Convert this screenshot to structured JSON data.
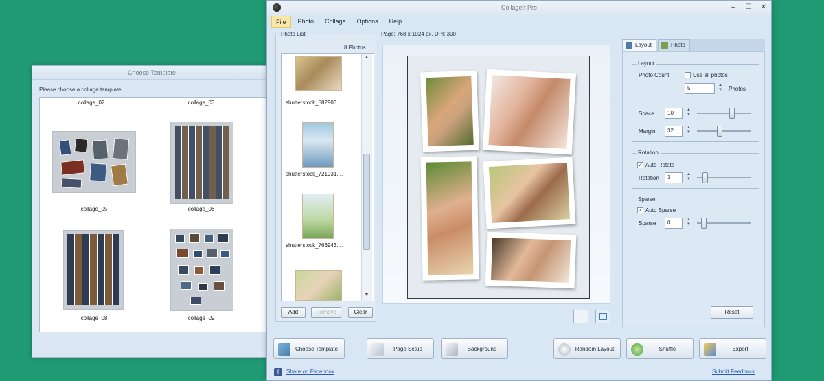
{
  "template_window": {
    "title": "Choose Template",
    "prompt": "Please choose a collage template",
    "templates": [
      {
        "label": "collage_02"
      },
      {
        "label": "collage_03"
      },
      {
        "label": "collage_05"
      },
      {
        "label": "collage_06"
      },
      {
        "label": "collage_08"
      },
      {
        "label": "collage_09"
      }
    ]
  },
  "main_window": {
    "title": "CollageIt Pro",
    "menu": [
      "File",
      "Photo",
      "Collage",
      "Options",
      "Help"
    ],
    "photo_list": {
      "legend": "Photo List",
      "count": "8 Photos",
      "items": [
        {
          "label": "shutterstock_582903...."
        },
        {
          "label": "shutterstock_721931...."
        },
        {
          "label": "shutterstock_766943...."
        }
      ],
      "add": "Add",
      "remove": "Remove",
      "clear": "Clear"
    },
    "page_info": "Page: 768 x 1024 px, DPI: 300",
    "tabs": [
      "Layout",
      "Photo"
    ],
    "layout": {
      "group_layout": "Layout",
      "photo_count_label": "Photo Count",
      "use_all_label": "Use all photos",
      "use_all_checked": false,
      "photo_count": "5",
      "photos_unit": "Photos",
      "space_label": "Space",
      "space": "10",
      "margin_label": "Margin",
      "margin": "32",
      "group_rotation": "Rotation",
      "auto_rotate_label": "Auto Rotate",
      "auto_rotate_checked": true,
      "rotation_label": "Rotation",
      "rotation": "3",
      "group_sparse": "Sparse",
      "auto_sparse_label": "Auto Sparse",
      "auto_sparse_checked": true,
      "sparse_label": "Sparse",
      "sparse": "0",
      "reset": "Reset"
    },
    "buttons": {
      "choose_template": "Choose Template",
      "page_setup": "Page Setup",
      "background": "Background",
      "random_layout": "Random Layout",
      "shuffle": "Shuffle",
      "export": "Export"
    },
    "links": {
      "share": "Share on Facebook",
      "feedback": "Submit Feedback"
    },
    "check_mark": "✓",
    "colors": {
      "desktop": "#1f9a73",
      "window": "#d9e6f3",
      "menu_active": "#f8e7a5"
    }
  }
}
